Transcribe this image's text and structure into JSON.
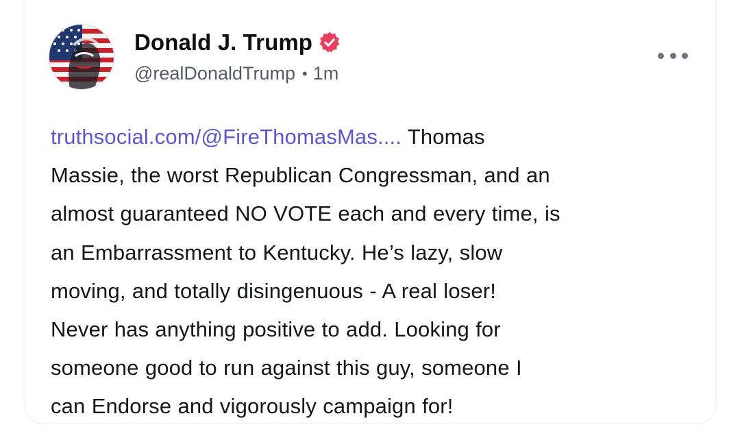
{
  "post": {
    "author": {
      "display_name": "Donald J. Trump",
      "handle": "@realDonaldTrump",
      "verified": true,
      "avatar": "patriotic-flag-portrait"
    },
    "separator": "•",
    "timestamp": "1m",
    "more_icon": "more-horizontal-icon",
    "link_text": "truthsocial.com/@FireThomasMas....",
    "lines": [
      "Thomas",
      "Massie, the worst Republican Congressman, and an",
      "almost guaranteed NO VOTE each and every time, is",
      "an Embarrassment to Kentucky. He’s lazy, slow",
      "moving, and totally disingenuous - A real loser!",
      "Never has anything positive to add. Looking for",
      "someone good to run against this guy, someone I",
      "can Endorse and vigorously campaign for!"
    ]
  },
  "colors": {
    "link": "#5f57c9",
    "verified_badge": "#e8415f",
    "text": "#14161b",
    "meta": "#545a66"
  }
}
